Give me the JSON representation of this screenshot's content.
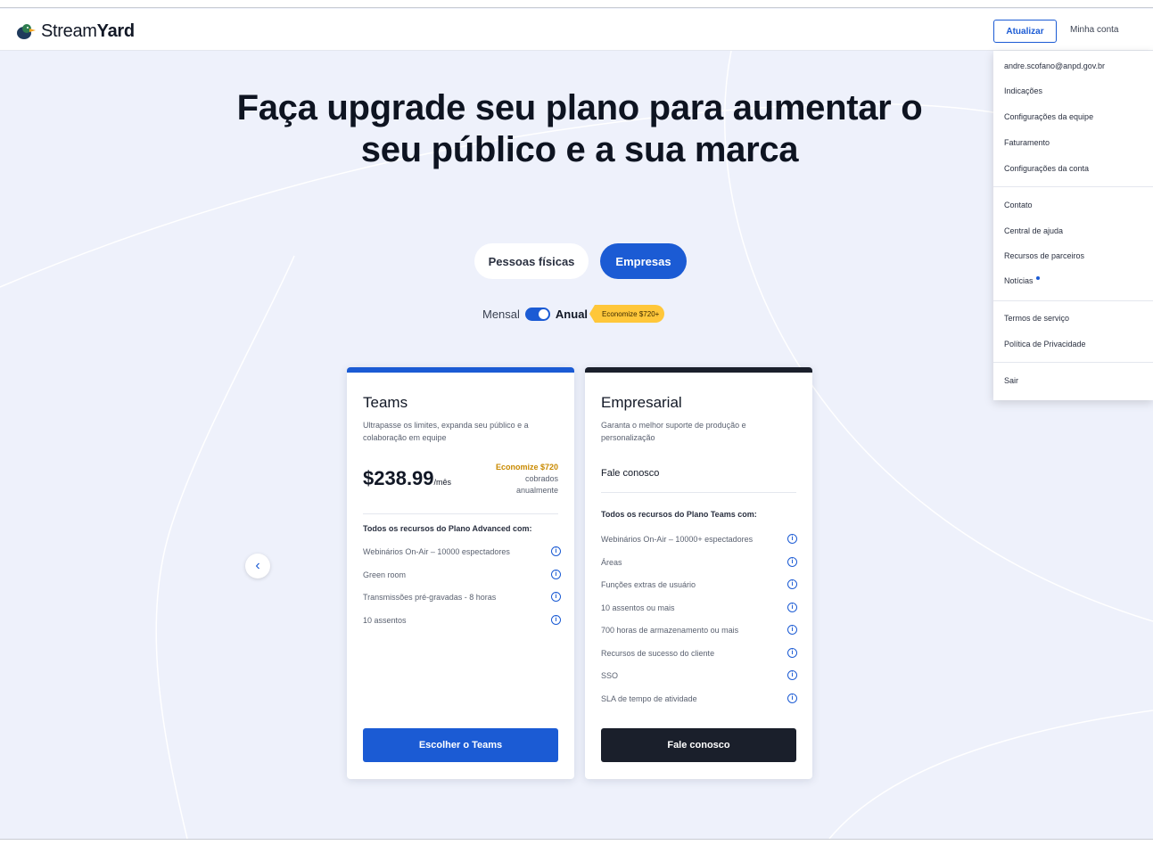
{
  "header": {
    "brand_prefix": "Stream",
    "brand_bold": "Yard",
    "upgrade_label": "Atualizar",
    "account_label": "Minha conta"
  },
  "hero": {
    "title": "Faça upgrade seu plano para aumentar o seu público e a sua marca"
  },
  "audience_tabs": {
    "people": "Pessoas físicas",
    "business": "Empresas",
    "selected": "business"
  },
  "billing": {
    "monthly": "Mensal",
    "annual": "Anual",
    "annual_selected": true,
    "badge": "Economize $720+"
  },
  "plans": {
    "teams": {
      "title": "Teams",
      "description": "Ultrapasse os limites, expanda seu público e a colaboração em equipe",
      "price": "$238.99",
      "per": "/mês",
      "savings": "Economize $720",
      "billed_1": "cobrados",
      "billed_2": "anualmente",
      "features_heading": "Todos os recursos do Plano Advanced com:",
      "features": [
        "Webinários On-Air – 10000 espectadores",
        "Green room",
        "Transmissões pré-gravadas - 8 horas",
        "10 assentos"
      ],
      "cta": "Escolher o Teams"
    },
    "enterprise": {
      "title": "Empresarial",
      "description": "Garanta o melhor suporte de produção e personalização",
      "contact": "Fale conosco",
      "features_heading": "Todos os recursos do Plano Teams com:",
      "features": [
        "Webinários On-Air – 10000+ espectadores",
        "Áreas",
        "Funções extras de usuário",
        "10 assentos ou mais",
        "700 horas de armazenamento ou mais",
        "Recursos de sucesso do cliente",
        "SSO",
        "SLA de tempo de atividade"
      ],
      "cta": "Fale conosco"
    }
  },
  "account_menu": {
    "email": "andre.scofano@anpd.gov.br",
    "items": [
      "Indicações",
      "Configurações da equipe",
      "Faturamento",
      "Configurações da conta",
      "Contato",
      "Central de ajuda",
      "Recursos de parceiros",
      "Notícias",
      "Termos de serviço",
      "Política de Privacidade",
      "Sair"
    ]
  },
  "icons": {
    "logo": "streamyard-duck-logo",
    "info": "info-circle-icon",
    "prev": "chevron-left-icon"
  },
  "colors": {
    "primary": "#1b5bd4",
    "dark": "#1a1f2b",
    "badge": "#ffc73a",
    "background": "#eef1fb"
  }
}
